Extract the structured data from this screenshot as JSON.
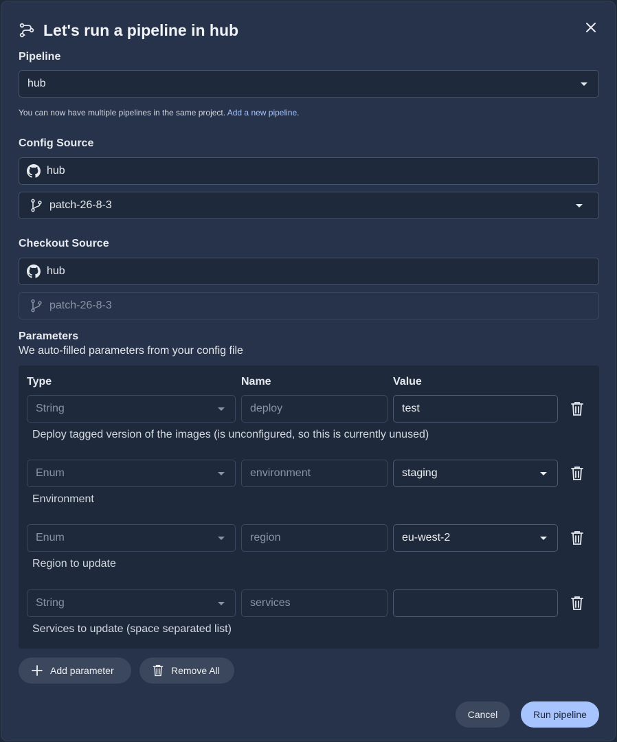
{
  "dialog": {
    "title": "Let's run a pipeline in hub",
    "close_icon": "close-icon",
    "title_icon": "pipeline-icon"
  },
  "pipeline": {
    "label": "Pipeline",
    "value": "hub",
    "hint_text": "You can now have multiple pipelines in the same project.",
    "hint_link": "Add a new pipeline",
    "hint_end": "."
  },
  "config_source": {
    "label": "Config Source",
    "repo": "hub",
    "branch": "patch-26-8-3"
  },
  "checkout_source": {
    "label": "Checkout Source",
    "repo": "hub",
    "branch": "patch-26-8-3"
  },
  "parameters": {
    "title": "Parameters",
    "subtitle": "We auto-filled parameters from your config file",
    "headers": {
      "type": "Type",
      "name": "Name",
      "value": "Value"
    },
    "rows": [
      {
        "type": "String",
        "name": "deploy",
        "value": "test",
        "value_is_select": false,
        "description": "Deploy tagged version of the images (is unconfigured, so this is currently unused)"
      },
      {
        "type": "Enum",
        "name": "environment",
        "value": "staging",
        "value_is_select": true,
        "description": "Environment"
      },
      {
        "type": "Enum",
        "name": "region",
        "value": "eu-west-2",
        "value_is_select": true,
        "description": "Region to update"
      },
      {
        "type": "String",
        "name": "services",
        "value": "",
        "value_is_select": false,
        "description": "Services to update (space separated list)"
      }
    ]
  },
  "actions": {
    "add_parameter": "Add parameter",
    "remove_all": "Remove All",
    "cancel": "Cancel",
    "run": "Run pipeline"
  },
  "colors": {
    "background": "#27334a",
    "field": "#1e2a3b",
    "primary": "#a8c4ff"
  }
}
